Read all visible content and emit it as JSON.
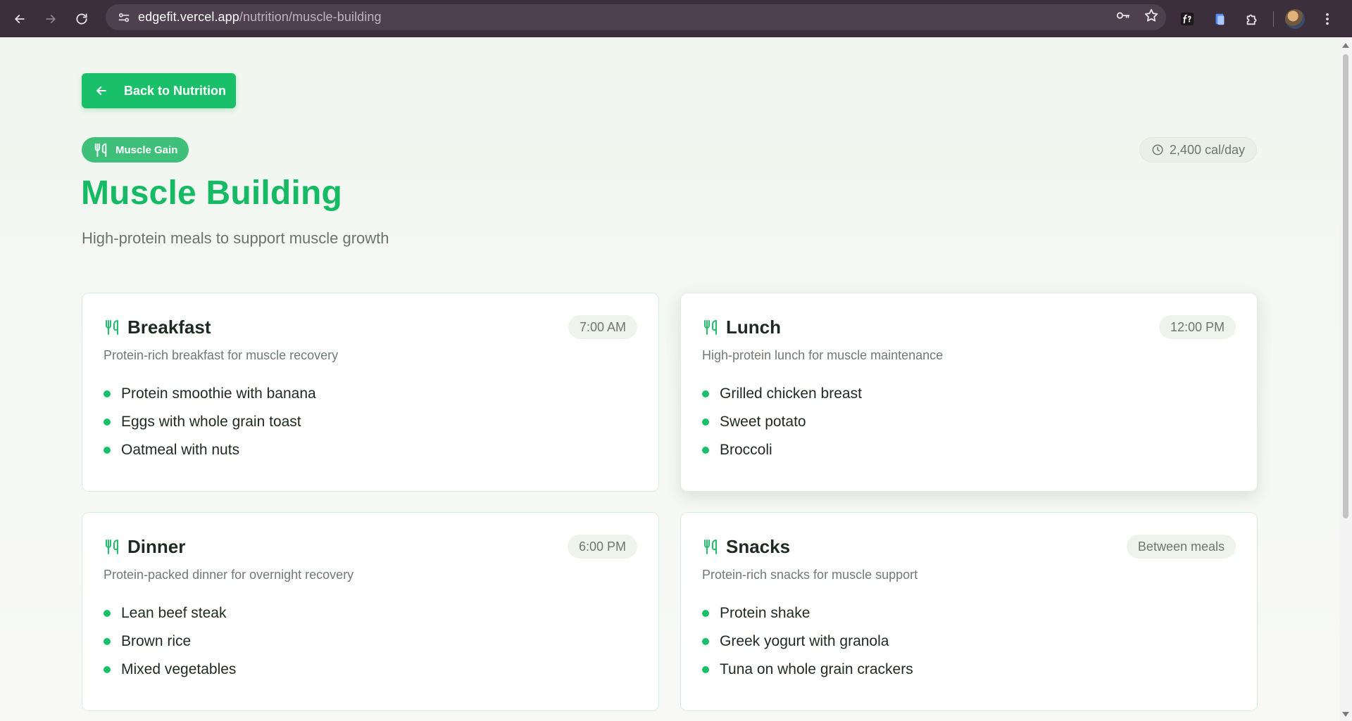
{
  "browser": {
    "url_host": "edgefit.vercel.app",
    "url_path": "/nutrition/muscle-building"
  },
  "page": {
    "back_label": "Back to Nutrition",
    "tag_label": "Muscle Gain",
    "calories": "2,400 cal/day",
    "title": "Muscle Building",
    "subtitle": "High-protein meals to support muscle growth"
  },
  "meals": [
    {
      "name": "Breakfast",
      "time": "7:00 AM",
      "description": "Protein-rich breakfast for muscle recovery",
      "items": [
        "Protein smoothie with banana",
        "Eggs with whole grain toast",
        "Oatmeal with nuts"
      ]
    },
    {
      "name": "Lunch",
      "time": "12:00 PM",
      "description": "High-protein lunch for muscle maintenance",
      "items": [
        "Grilled chicken breast",
        "Sweet potato",
        "Broccoli"
      ]
    },
    {
      "name": "Dinner",
      "time": "6:00 PM",
      "description": "Protein-packed dinner for overnight recovery",
      "items": [
        "Lean beef steak",
        "Brown rice",
        "Mixed vegetables"
      ]
    },
    {
      "name": "Snacks",
      "time": "Between meals",
      "description": "Protein-rich snacks for muscle support",
      "items": [
        "Protein shake",
        "Greek yogurt with granola",
        "Tuna on whole grain crackers"
      ]
    }
  ],
  "colors": {
    "accent": "#19c069",
    "title": "#16b964",
    "chrome": "#3c2f3c"
  }
}
